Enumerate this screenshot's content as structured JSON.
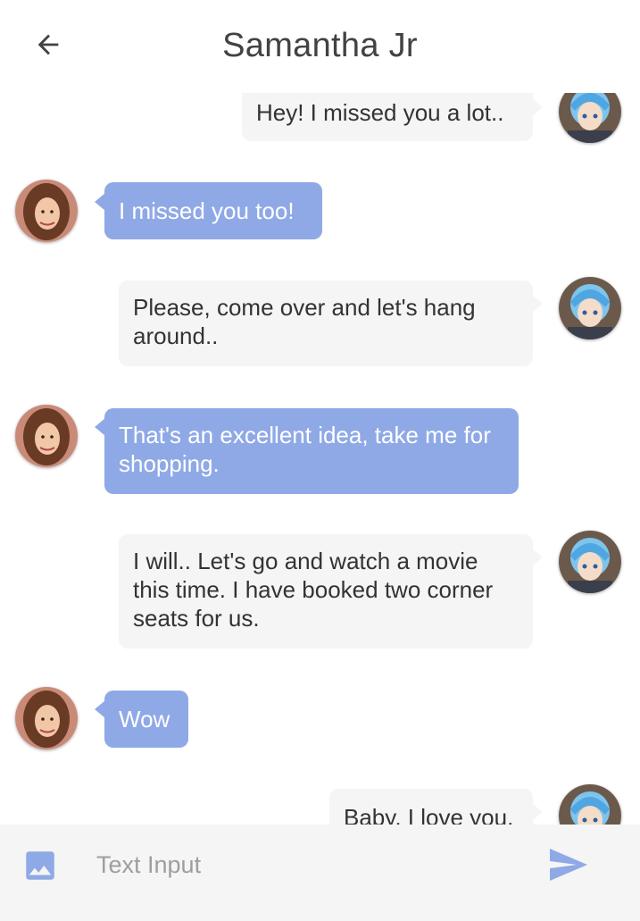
{
  "header": {
    "title": "Samantha Jr",
    "back_icon": "arrow-back-icon"
  },
  "messages": [
    {
      "sender": "me",
      "text": "Hey! I missed you a lot.."
    },
    {
      "sender": "her",
      "text": "I missed you too!"
    },
    {
      "sender": "me",
      "text": "Please, come over and let's hang around.."
    },
    {
      "sender": "her",
      "text": "That's an excellent idea, take me for shopping."
    },
    {
      "sender": "me",
      "text": "I will.. Let's go and watch a movie this time. I have booked two corner seats for us."
    },
    {
      "sender": "her",
      "text": "Wow"
    },
    {
      "sender": "me",
      "text": "Baby, I love you."
    }
  ],
  "composer": {
    "placeholder": "Text Input",
    "image_icon": "image-icon",
    "send_icon": "send-icon"
  },
  "colors": {
    "her_bubble": "#8fa9e6",
    "me_bubble": "#f5f5f5",
    "accent": "#8fa9e6"
  }
}
